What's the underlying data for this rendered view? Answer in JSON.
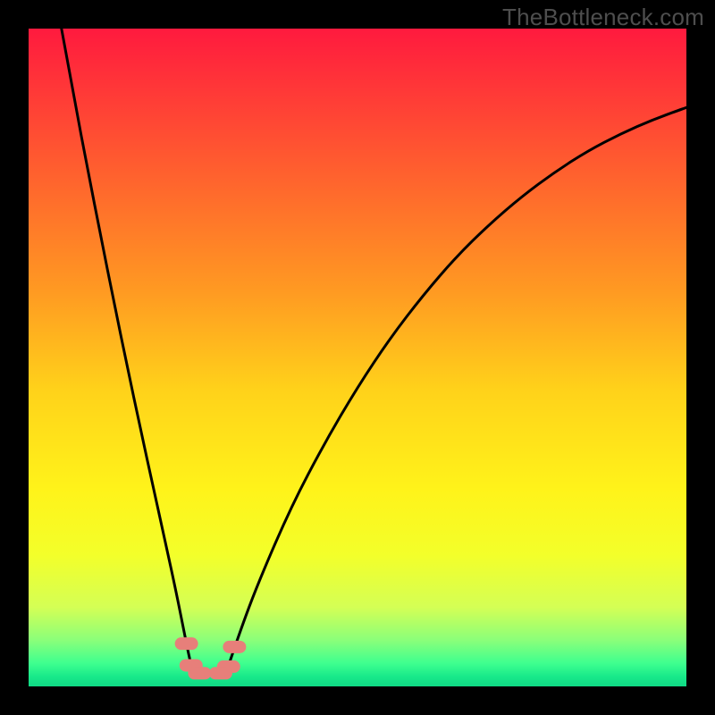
{
  "watermark": "TheBottleneck.com",
  "chart_data": {
    "type": "line",
    "title": "",
    "xlabel": "",
    "ylabel": "",
    "xlim": [
      0,
      100
    ],
    "ylim": [
      0,
      100
    ],
    "gradient_stops": [
      {
        "offset": 0.0,
        "color": "#ff1a3e"
      },
      {
        "offset": 0.1,
        "color": "#ff3a37"
      },
      {
        "offset": 0.25,
        "color": "#ff6a2c"
      },
      {
        "offset": 0.4,
        "color": "#ff9a22"
      },
      {
        "offset": 0.55,
        "color": "#ffd21a"
      },
      {
        "offset": 0.7,
        "color": "#fff31a"
      },
      {
        "offset": 0.8,
        "color": "#f3ff2a"
      },
      {
        "offset": 0.88,
        "color": "#d4ff55"
      },
      {
        "offset": 0.93,
        "color": "#8aff7a"
      },
      {
        "offset": 0.965,
        "color": "#3eff8f"
      },
      {
        "offset": 0.985,
        "color": "#18e98a"
      },
      {
        "offset": 1.0,
        "color": "#10d985"
      }
    ],
    "series": [
      {
        "name": "left-curve",
        "x": [
          5.0,
          7.0,
          9.0,
          11.0,
          13.0,
          15.0,
          17.0,
          19.0,
          21.0,
          22.5,
          23.5,
          24.3,
          25.0
        ],
        "y": [
          100.0,
          89.0,
          78.5,
          68.3,
          58.3,
          48.6,
          39.2,
          30.0,
          21.0,
          14.0,
          9.0,
          5.0,
          2.0
        ]
      },
      {
        "name": "right-curve",
        "x": [
          30.0,
          32.0,
          35.0,
          40.0,
          45.0,
          50.0,
          55.0,
          60.0,
          65.0,
          70.0,
          75.0,
          80.0,
          85.0,
          90.0,
          95.0,
          100.0
        ],
        "y": [
          2.0,
          8.0,
          16.0,
          27.5,
          37.0,
          45.5,
          53.0,
          59.5,
          65.3,
          70.2,
          74.5,
          78.2,
          81.4,
          84.0,
          86.2,
          88.0
        ]
      },
      {
        "name": "floor",
        "x": [
          25.0,
          30.0
        ],
        "y": [
          2.0,
          2.0
        ]
      }
    ],
    "markers": [
      {
        "name": "left-marker-upper",
        "x": 24.0,
        "y": 6.5,
        "color": "#e77f7a"
      },
      {
        "name": "left-marker-lower",
        "x": 24.7,
        "y": 3.2,
        "color": "#e77f7a"
      },
      {
        "name": "right-marker-upper",
        "x": 31.3,
        "y": 6.0,
        "color": "#e77f7a"
      },
      {
        "name": "right-marker-lower",
        "x": 30.4,
        "y": 3.0,
        "color": "#e77f7a"
      },
      {
        "name": "floor-marker-left",
        "x": 26.0,
        "y": 2.0,
        "color": "#e77f7a"
      },
      {
        "name": "floor-marker-right",
        "x": 29.2,
        "y": 2.0,
        "color": "#e77f7a"
      }
    ]
  }
}
